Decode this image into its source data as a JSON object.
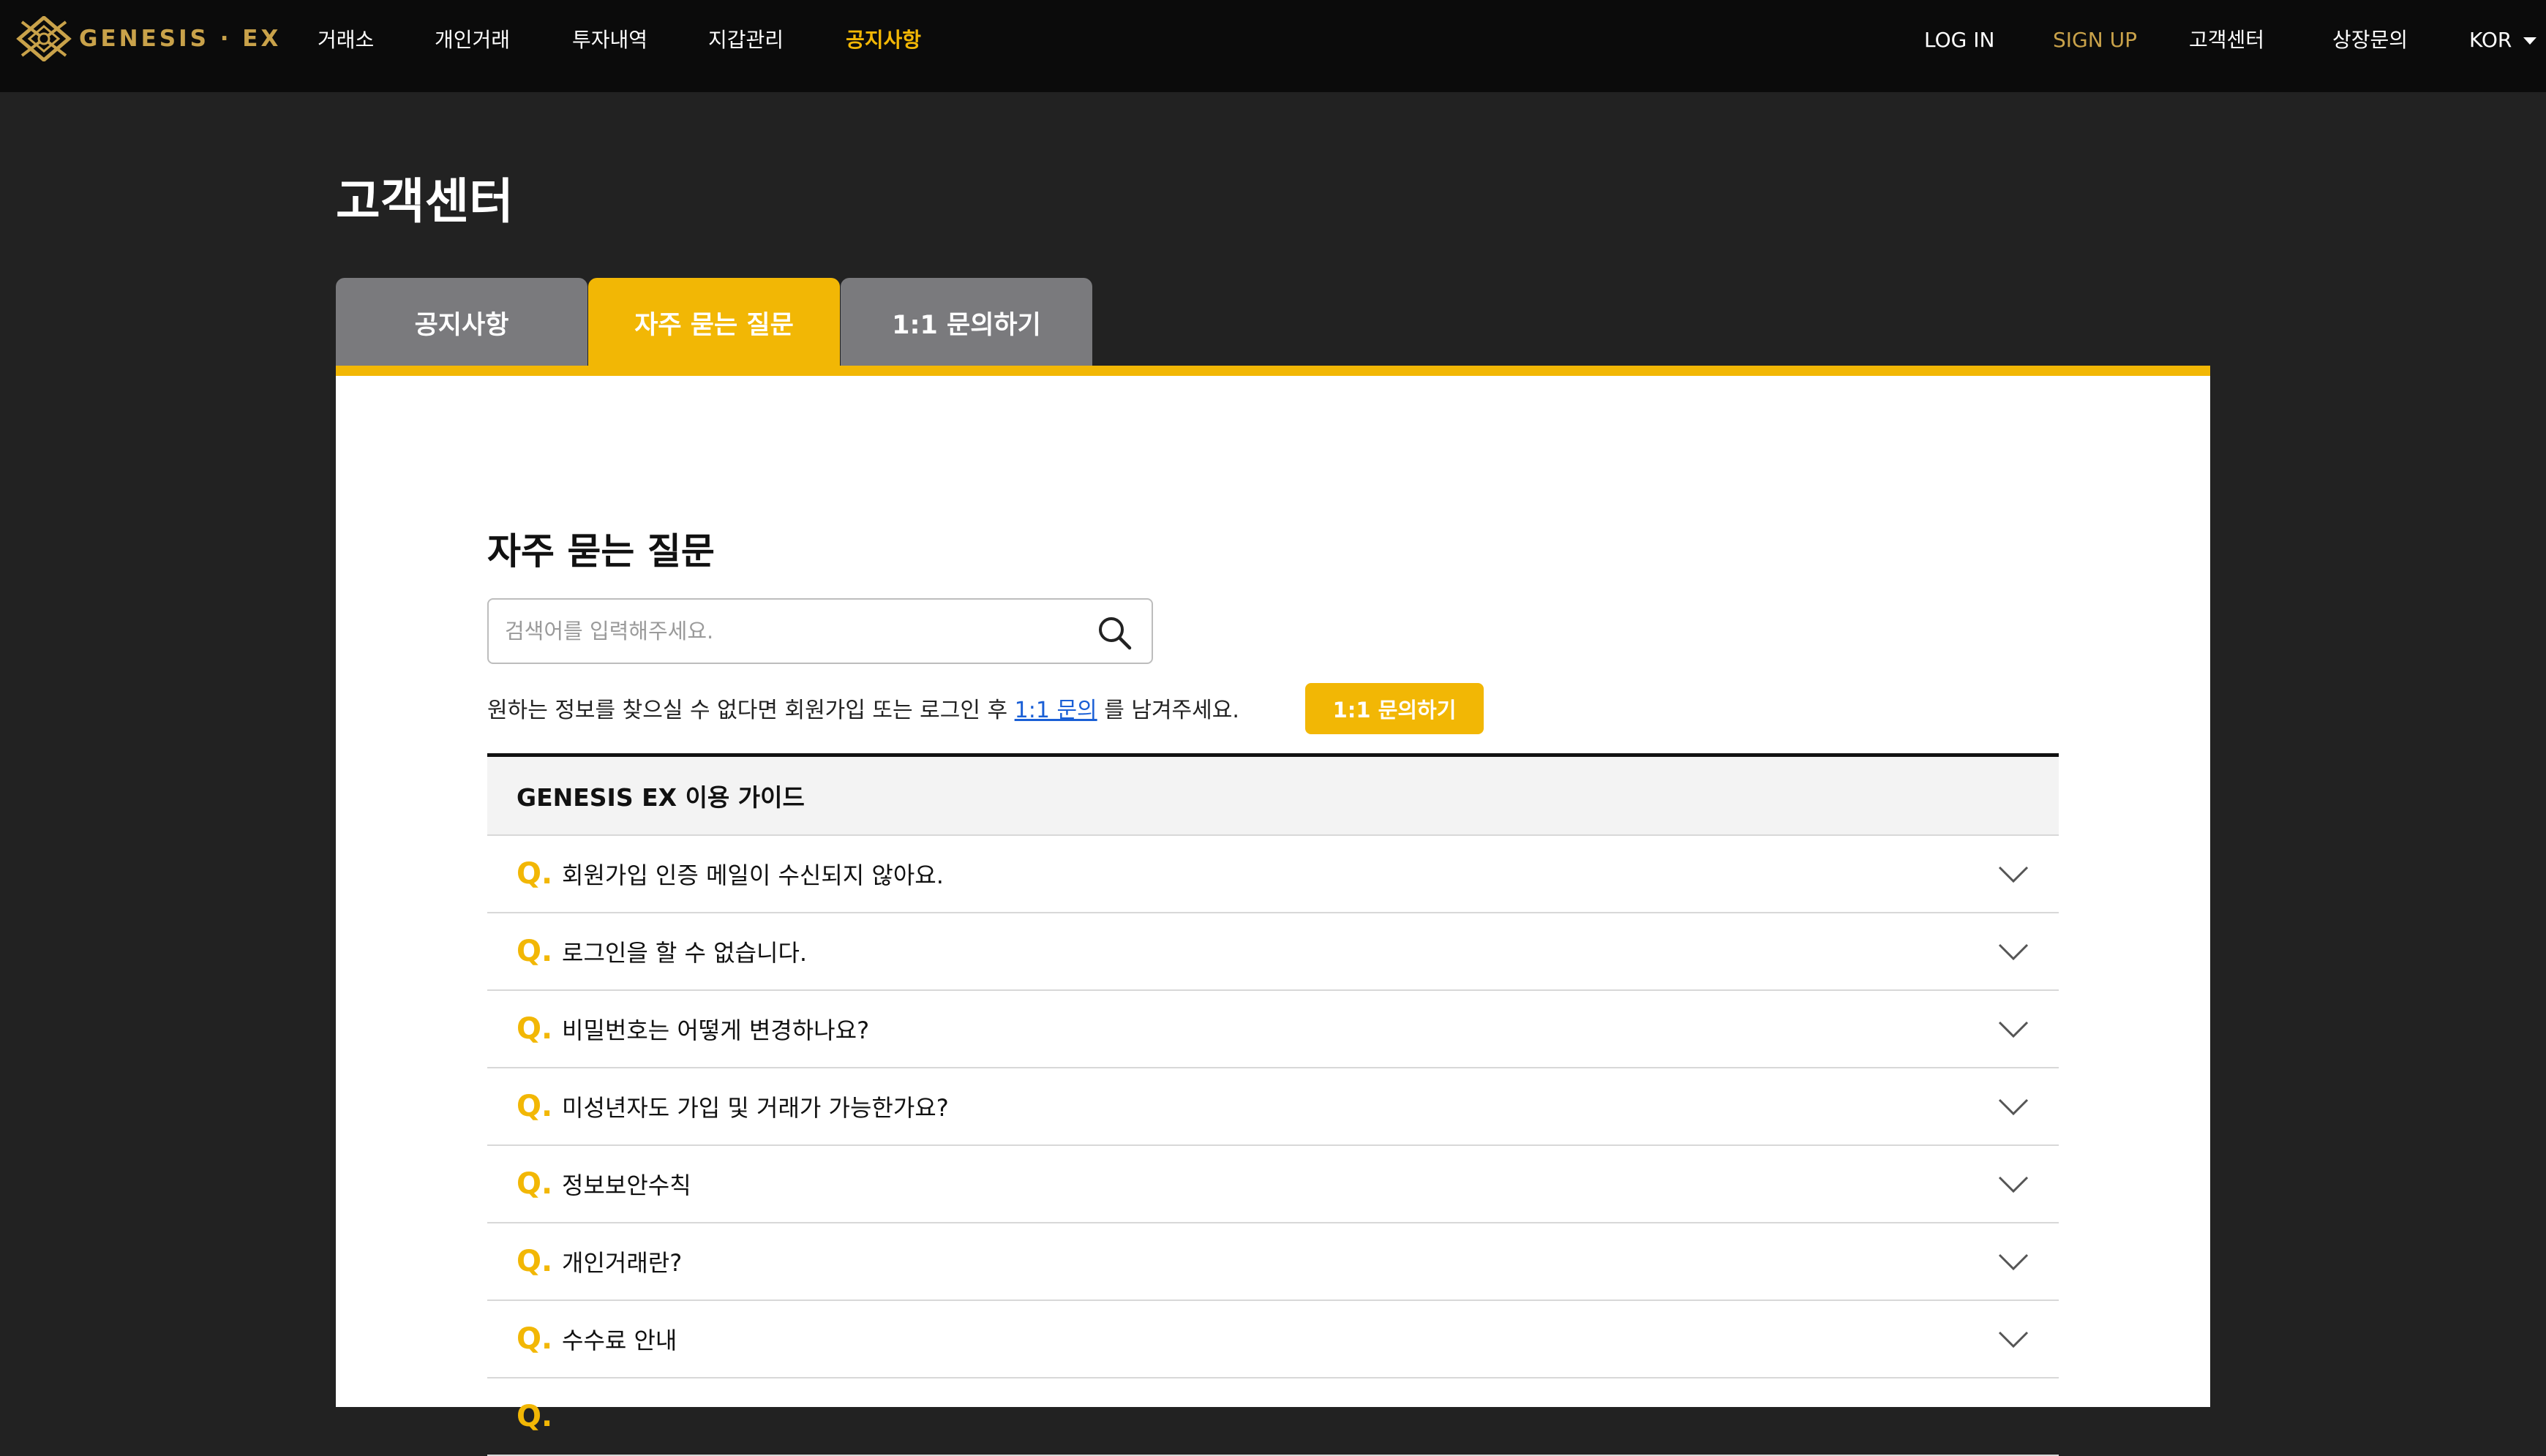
{
  "header": {
    "logo_text": "GENESIS · EX",
    "nav": [
      {
        "label": "거래소",
        "active": false
      },
      {
        "label": "개인거래",
        "active": false
      },
      {
        "label": "투자내역",
        "active": false
      },
      {
        "label": "지갑관리",
        "active": false
      },
      {
        "label": "공지사항",
        "active": true
      }
    ],
    "login": "LOG IN",
    "signup": "SIGN UP",
    "support": "고객센터",
    "listing": "상장문의",
    "language": "KOR"
  },
  "page": {
    "title": "고객센터",
    "tabs": [
      {
        "label": "공지사항",
        "active": false
      },
      {
        "label": "자주 묻는 질문",
        "active": true
      },
      {
        "label": "1:1 문의하기",
        "active": false
      }
    ]
  },
  "faq": {
    "title": "자주 묻는 질문",
    "search_placeholder": "검색어를 입력해주세요.",
    "help_prefix": "원하는 정보를 찾으실 수 없다면 회원가입 또는 로그인 후",
    "help_link": "1:1 문의",
    "help_suffix": "를 남겨주세요.",
    "inquiry_button": "1:1 문의하기",
    "category": "GENESIS EX 이용 가이드",
    "q_mark": "Q.",
    "questions": [
      "회원가입 인증 메일이 수신되지 않아요.",
      "로그인을 할 수 없습니다.",
      "비밀번호는 어떻게 변경하나요?",
      "미성년자도 가입 및 거래가 가능한가요?",
      "정보보안수칙",
      "개인거래란?",
      "수수료 안내"
    ]
  },
  "colors": {
    "accent": "#f2b705",
    "logo_gold": "#c9a24a",
    "background": "#222222",
    "topbar": "#0b0b0b",
    "tab_inactive": "#7a7a7d",
    "link": "#1a5fd6"
  },
  "icons": [
    "genesis-logo-icon",
    "search-icon",
    "chevron-down-icon",
    "caret-down-icon"
  ]
}
